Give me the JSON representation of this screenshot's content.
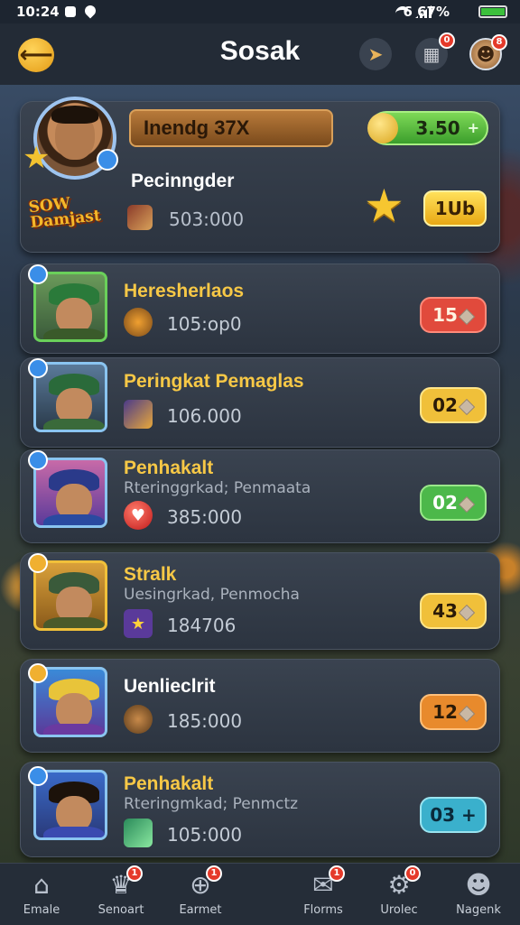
{
  "status_bar": {
    "time": "10:24",
    "battery_text": "6 67%"
  },
  "header": {
    "title": "Sosak",
    "icons": [
      "megaphone-icon",
      "bookmark-icon",
      "avatar-icon"
    ],
    "badges": {
      "bookmark": "0",
      "avatar": "8"
    }
  },
  "top_card": {
    "rank_label": "Inendg 37X",
    "gems": "3.50",
    "player_name": "Pecinngder",
    "logo_text": "SOW Damjast",
    "score": "503:000",
    "button_label": "1Ub"
  },
  "rows": [
    {
      "name": "Heresherlaos",
      "sub": "",
      "score": "105:op0",
      "pill": "15",
      "pill_color": "#e14a3c"
    },
    {
      "name": "Peringkat Pemaglas",
      "sub": "",
      "score": "106.000",
      "pill": "02",
      "pill_color": "#f0c03a"
    },
    {
      "name": "Penhakalt",
      "sub": "Rteringgrkad; Penmaata",
      "score": "385:000",
      "pill": "02",
      "pill_color": "#4cb84a"
    },
    {
      "name": "Stralk",
      "sub": "Uesingrkad, Penmocha",
      "score": "184706",
      "pill": "43",
      "pill_color": "#f0c03a"
    },
    {
      "name": "Uenlieclrit",
      "sub": "",
      "score": "185:000",
      "pill": "12",
      "pill_color": "#e88a2c"
    },
    {
      "name": "Penhakalt",
      "sub": "Rteringmkad; Penmctz",
      "score": "105:000",
      "pill": "03",
      "pill_color": "#3ab0cc"
    }
  ],
  "navbar": {
    "items": [
      {
        "label": "Emale",
        "badge": ""
      },
      {
        "label": "Senoart",
        "badge": "1"
      },
      {
        "label": "Earmet",
        "badge": "1"
      },
      {
        "label": "Florms",
        "badge": "1"
      },
      {
        "label": "Urolec",
        "badge": "0"
      },
      {
        "label": "Nagenk",
        "badge": ""
      }
    ]
  },
  "colors": {
    "accent_gold": "#f7c846",
    "card_bg": "#3a4350"
  }
}
